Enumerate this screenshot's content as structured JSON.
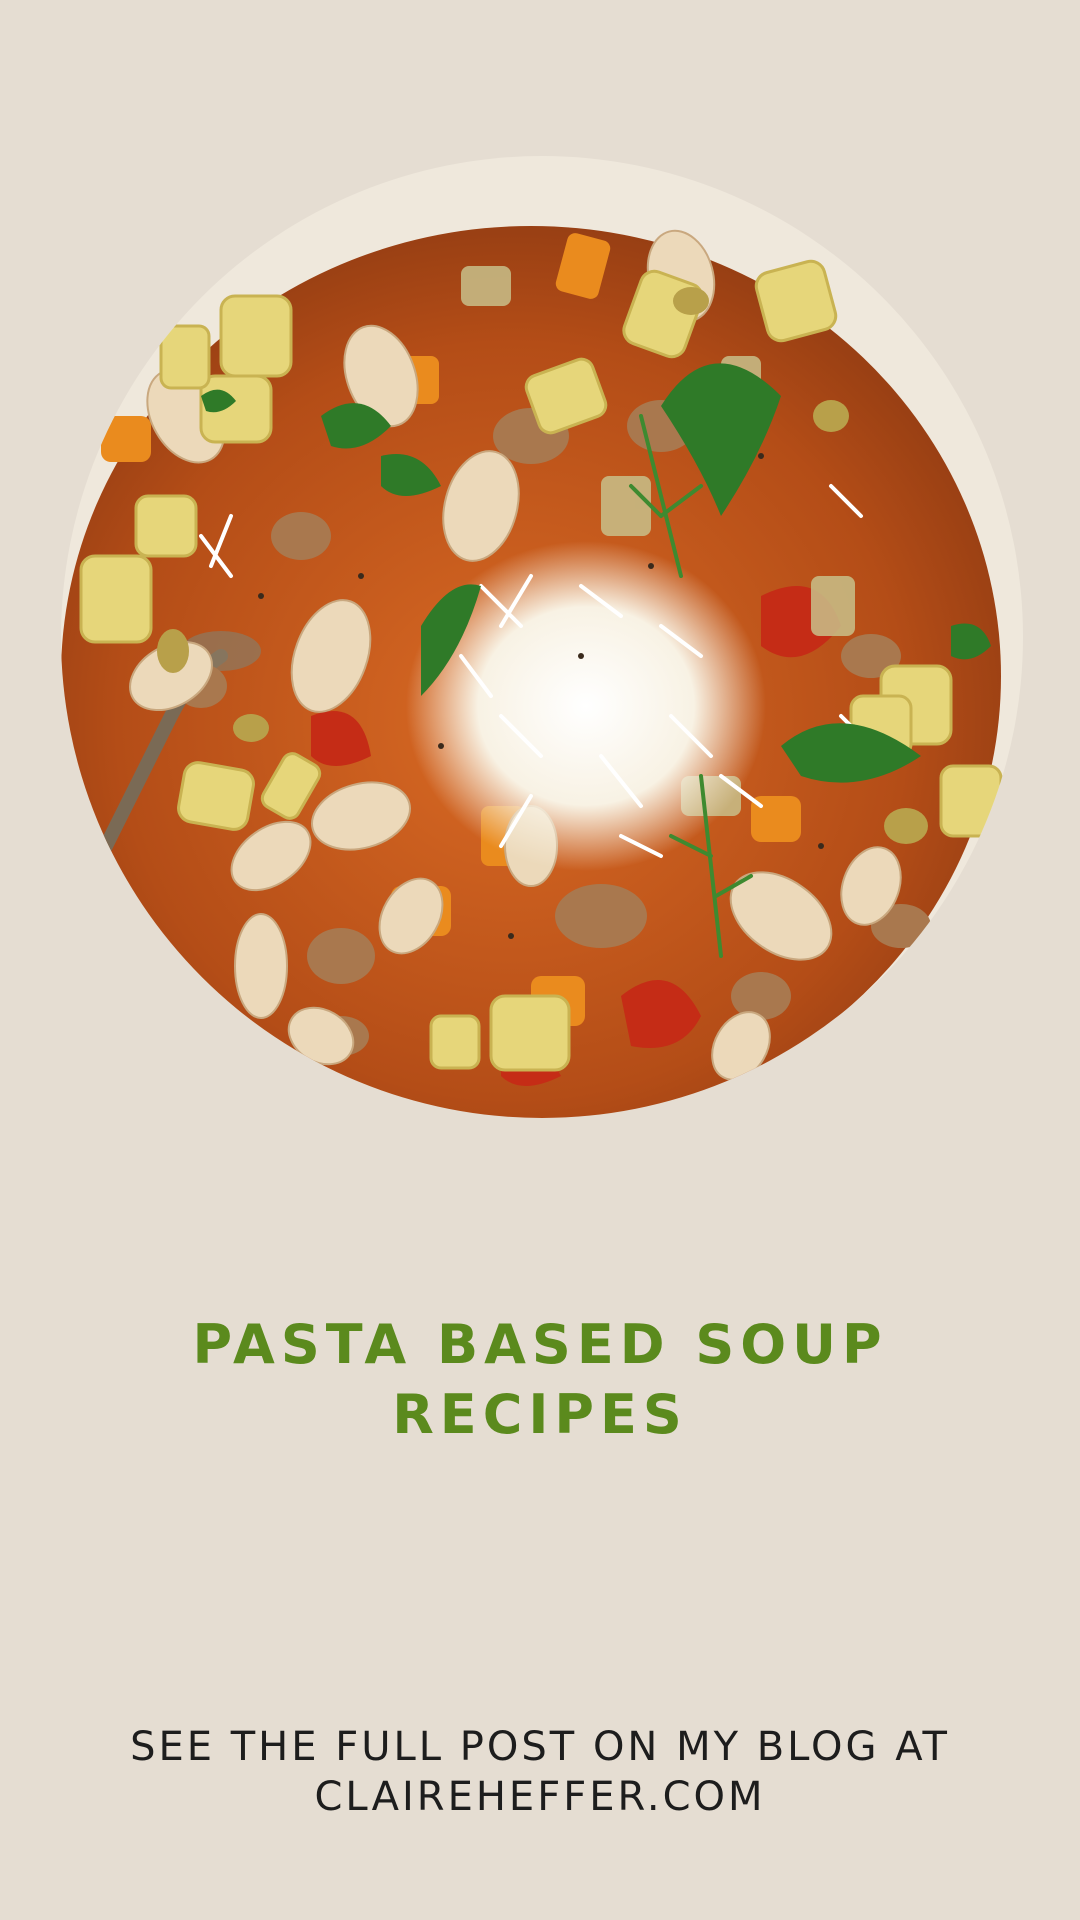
{
  "hero_image": {
    "subject": "pasta soup bowl",
    "colors": {
      "bowl_rim": "#f1ece2",
      "broth": "#c4571c",
      "pasta": "#e8d77a",
      "beans": "#ead6b8",
      "herbs": "#2f7a28",
      "cheese": "#fbf7ee",
      "tomato": "#c42b17",
      "carrot": "#e98a1f",
      "sausage": "#a9784e"
    }
  },
  "title": {
    "line1": "PASTA BASED SOUP",
    "line2": "RECIPES",
    "color": "#5b8a1d"
  },
  "footer": {
    "line1": "SEE THE FULL POST ON MY BLOG AT",
    "line2": "CLAIREHEFFER.COM"
  },
  "background_color": "#e5ddd2"
}
